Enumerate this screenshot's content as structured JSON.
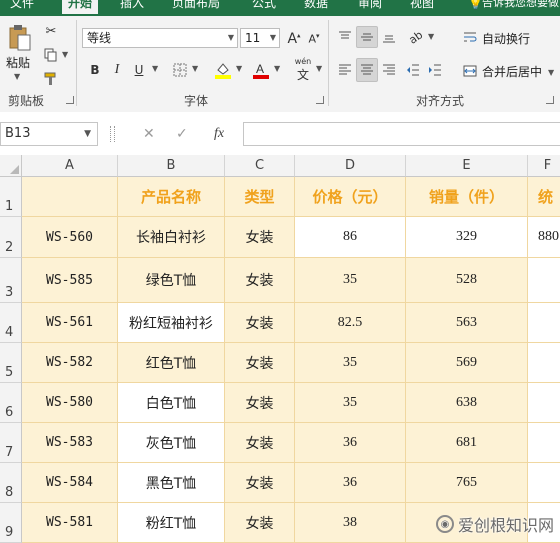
{
  "tabs": [
    "文件",
    "开始",
    "插入",
    "页面布局",
    "公式",
    "数据",
    "审阅",
    "视图"
  ],
  "tell_me": "告诉我您想要做",
  "ribbon": {
    "paste_label": "粘贴",
    "clipboard_label": "剪贴板",
    "font_label": "字体",
    "alignment_label": "对齐方式",
    "font_name": "等线",
    "font_size": "11",
    "bold": "B",
    "italic": "I",
    "underline": "U",
    "phonetic": "wén",
    "wrap_text": "自动换行",
    "merge_center": "合并后居中"
  },
  "formula_bar": {
    "name_box": "B13",
    "cancel": "✕",
    "enter": "✓",
    "fx": "fx",
    "value": ""
  },
  "columns": [
    "A",
    "B",
    "C",
    "D",
    "E",
    "F"
  ],
  "row_numbers": [
    "1",
    "2",
    "3",
    "4",
    "5",
    "6",
    "7",
    "8",
    "9"
  ],
  "rows": [
    [
      "",
      "产品名称",
      "类型",
      "价格（元）",
      "销量（件）",
      "统"
    ],
    [
      "WS-560",
      "长袖白衬衫",
      "女装",
      "86",
      "329",
      "880"
    ],
    [
      "WS-585",
      "绿色T恤",
      "女装",
      "35",
      "528",
      ""
    ],
    [
      "WS-561",
      "粉红短袖衬衫",
      "女装",
      "82.5",
      "563",
      ""
    ],
    [
      "WS-582",
      "红色T恤",
      "女装",
      "35",
      "569",
      ""
    ],
    [
      "WS-580",
      "白色T恤",
      "女装",
      "35",
      "638",
      ""
    ],
    [
      "WS-583",
      "灰色T恤",
      "女装",
      "36",
      "681",
      ""
    ],
    [
      "WS-584",
      "黑色T恤",
      "女装",
      "36",
      "765",
      ""
    ],
    [
      "WS-581",
      "粉红T恤",
      "女装",
      "38",
      "",
      ""
    ]
  ],
  "watermark": "爱创根知识网",
  "colors": {
    "excel_green": "#217346",
    "header_text": "#f0a21d",
    "cell_fill": "#fdf2d5",
    "white_fill": "#ffffff",
    "cell_border": "#f0d7a0"
  }
}
